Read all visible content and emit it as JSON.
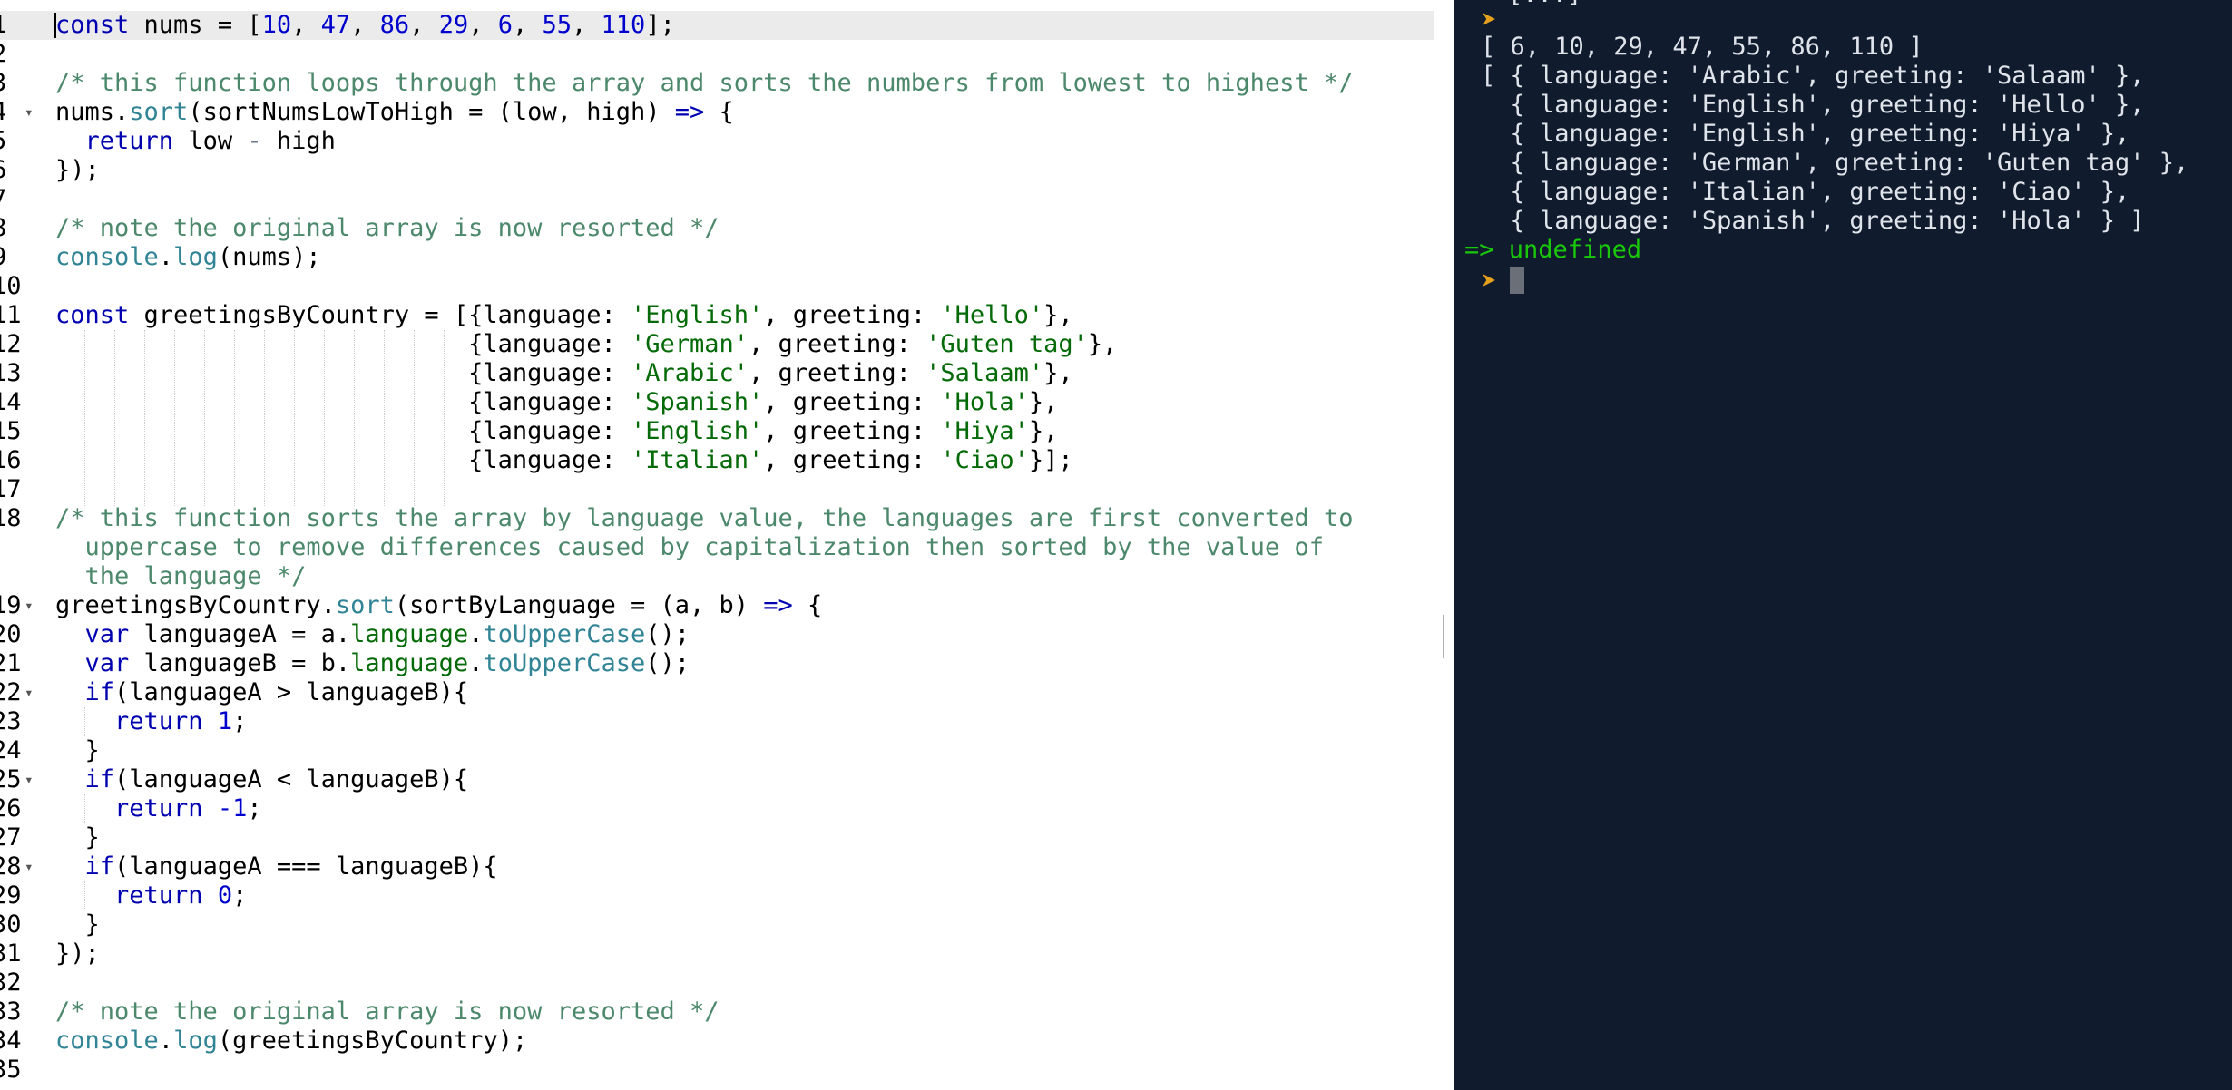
{
  "editor": {
    "line_numbers": [
      "1",
      "2",
      "3",
      "4",
      "5",
      "6",
      "7",
      "8",
      "9",
      "10",
      "11",
      "12",
      "13",
      "14",
      "15",
      "16",
      "17",
      "18",
      "",
      "",
      "19",
      "20",
      "21",
      "22",
      "23",
      "24",
      "25",
      "26",
      "27",
      "28",
      "29",
      "30",
      "31",
      "32",
      "33",
      "34",
      "35"
    ],
    "lines": {
      "l1": {
        "a": "const",
        "b": " nums = [",
        "c": "10",
        ", ": ", ",
        "d": "47",
        "e": "86",
        "f": "29",
        "g": "6",
        "h": "55",
        "i": "110",
        "j": "];"
      },
      "l3": "/* this function loops through the array and sorts the numbers from lowest to highest */",
      "l4a": "nums.",
      "l4b": "sort",
      "l4c": "(sortNumsLowToHigh = (low, high) ",
      "l4d": "=>",
      "l4e": " {",
      "l5a": "  ",
      "l5b": "return",
      "l5c": " low ",
      "l5d": "-",
      "l5e": " high",
      "l6": "});",
      "l8": "/* note the original array is now resorted */",
      "l9a": "console",
      "l9b": ".",
      "l9c": "log",
      "l9d": "(nums);",
      "l11a": "const",
      "l11b": " greetingsByCountry = [{language: ",
      "l11c": "'English'",
      "l11d": ", greeting: ",
      "l11e": "'Hello'",
      "l11f": "},",
      "l12a": "                            {language: ",
      "l12b": "'German'",
      "l12c": ", greeting: ",
      "l12d": "'Guten tag'",
      "l12e": "},",
      "l13b": "'Arabic'",
      "l13d": "'Salaam'",
      "l14b": "'Spanish'",
      "l14d": "'Hola'",
      "l15b": "'English'",
      "l15d": "'Hiya'",
      "l16b": "'Italian'",
      "l16d": "'Ciao'",
      "l16e": "}];",
      "l18a": "/* this function sorts the array by language value, the languages are first converted to",
      "l18b": "  uppercase to remove differences caused by capitalization then sorted by the value of",
      "l18c": "  the language */",
      "l19a": "greetingsByCountry.",
      "l19b": "sort",
      "l19c": "(sortByLanguage = (a, b) ",
      "l19d": "=>",
      "l19e": " {",
      "var": "var",
      "l20a": " languageA = a.",
      "l20b": "language",
      "l20c": ".",
      "l20d": "toUpperCase",
      "l20e": "();",
      "l21a": " languageB = b.",
      "if": "if",
      "l22b": "(languageA > languageB){",
      "ret": "return",
      "l23b": "1",
      "semi": ";",
      "close": "}",
      "l25b": "(languageA < languageB){",
      "l26b": "-1",
      "l28b": "(languageA === languageB){",
      "l29b": "0",
      "l31": "});",
      "l33": "/* note the original array is now resorted */",
      "l34d": "(greetingsByCountry);"
    }
  },
  "console": {
    "top_cut": "[...]",
    "output_nums": "[ 6, 10, 29, 47, 55, 86, 110 ]",
    "output_objs": [
      "[ { language: 'Arabic', greeting: 'Salaam' },",
      "  { language: 'English', greeting: 'Hello' },",
      "  { language: 'English', greeting: 'Hiya' },",
      "  { language: 'German', greeting: 'Guten tag' },",
      "  { language: 'Italian', greeting: 'Ciao' },",
      "  { language: 'Spanish', greeting: 'Hola' } ]"
    ],
    "result_arrow": "=>",
    "result_value": "undefined"
  },
  "colors": {
    "console_bg": "#111b2e",
    "prompt": "#e5a11b",
    "result": "#19c70b",
    "keyword": "#0000b0",
    "string": "#036a07",
    "comment": "#4c886b"
  }
}
